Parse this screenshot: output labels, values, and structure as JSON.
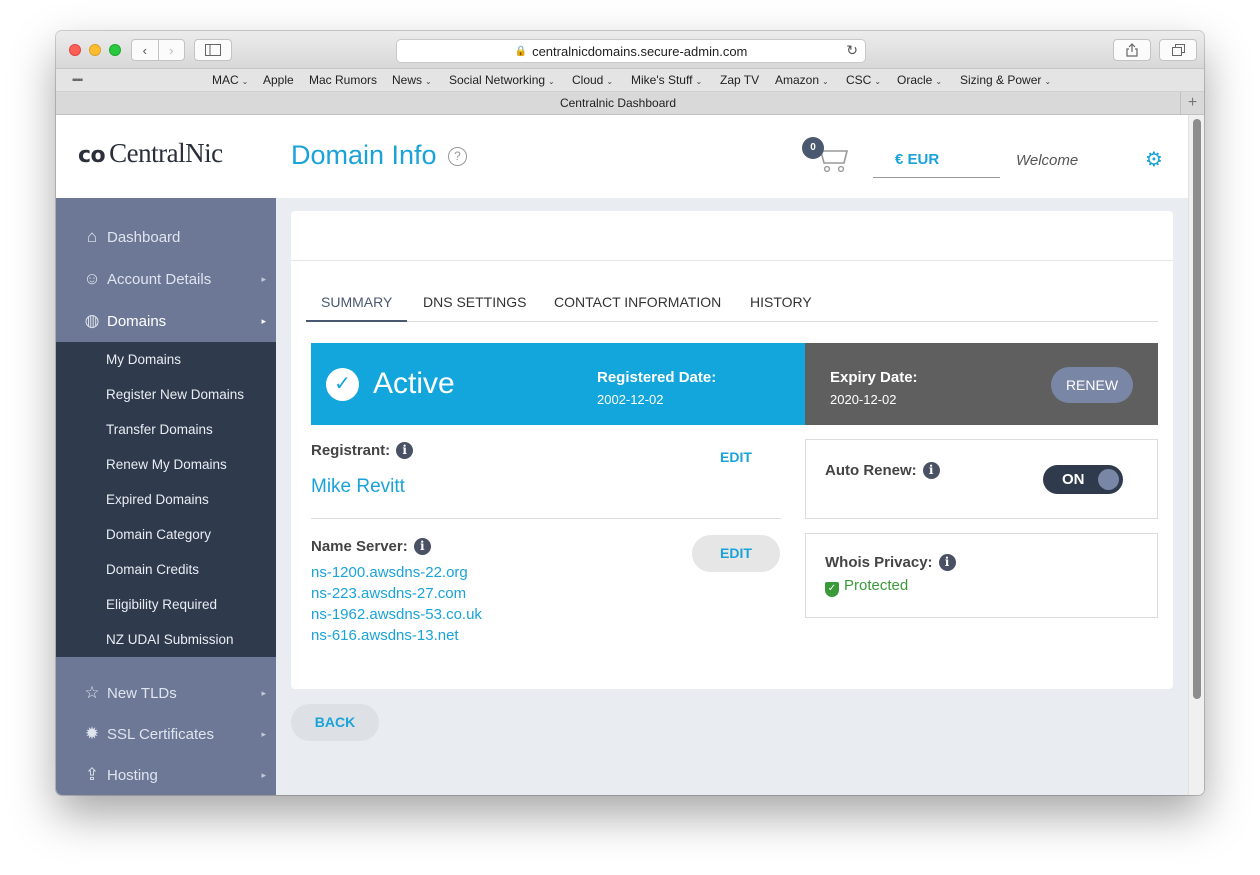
{
  "browser": {
    "url": "centralnicdomains.secure-admin.com",
    "tab_title": "Centralnic Dashboard",
    "bookmarks": [
      {
        "label": "MAC",
        "menu": true
      },
      {
        "label": "Apple",
        "menu": false
      },
      {
        "label": "Mac Rumors",
        "menu": false
      },
      {
        "label": "News",
        "menu": true
      },
      {
        "label": "Social Networking",
        "menu": true
      },
      {
        "label": "Cloud",
        "menu": true
      },
      {
        "label": "Mike's Stuff",
        "menu": true
      },
      {
        "label": "Zap TV",
        "menu": false
      },
      {
        "label": "Amazon",
        "menu": true
      },
      {
        "label": "CSC",
        "menu": true
      },
      {
        "label": "Oracle",
        "menu": true
      },
      {
        "label": "Sizing & Power",
        "menu": true
      }
    ]
  },
  "header": {
    "logo_text": "CentralNic",
    "page_title": "Domain Info",
    "cart_count": "0",
    "currency": "€ EUR",
    "welcome": "Welcome"
  },
  "sidebar": {
    "items": [
      {
        "label": "Dashboard",
        "icon": "home-icon"
      },
      {
        "label": "Account Details",
        "icon": "user-icon"
      },
      {
        "label": "Domains",
        "icon": "globe-icon"
      },
      {
        "label": "New TLDs",
        "icon": "star-icon"
      },
      {
        "label": "SSL Certificates",
        "icon": "badge-icon"
      },
      {
        "label": "Hosting",
        "icon": "upload-icon"
      }
    ],
    "domains_submenu": [
      "My Domains",
      "Register New Domains",
      "Transfer Domains",
      "Renew My Domains",
      "Expired Domains",
      "Domain Category",
      "Domain Credits",
      "Eligibility Required",
      "NZ UDAI Submission"
    ]
  },
  "tabs": [
    "SUMMARY",
    "DNS SETTINGS",
    "CONTACT INFORMATION",
    "HISTORY"
  ],
  "status": {
    "state": "Active",
    "registered_label": "Registered Date:",
    "registered_date": "2002-12-02",
    "expiry_label": "Expiry Date:",
    "expiry_date": "2020-12-02",
    "renew_label": "RENEW"
  },
  "registrant": {
    "label": "Registrant:",
    "name": "Mike Revitt",
    "edit_label": "EDIT"
  },
  "nameservers": {
    "label": "Name Server:",
    "edit_label": "EDIT",
    "list": [
      "ns-1200.awsdns-22.org",
      "ns-223.awsdns-27.com",
      "ns-1962.awsdns-53.co.uk",
      "ns-616.awsdns-13.net"
    ]
  },
  "auto_renew": {
    "label": "Auto Renew:",
    "state": "ON"
  },
  "whois": {
    "label": "Whois Privacy:",
    "status": "Protected"
  },
  "back_label": "BACK",
  "colors": {
    "accent": "#1aa3d9",
    "active_banner": "#12a6dd",
    "sidebar": "#6c7896",
    "submenu": "#2f3a4c"
  }
}
